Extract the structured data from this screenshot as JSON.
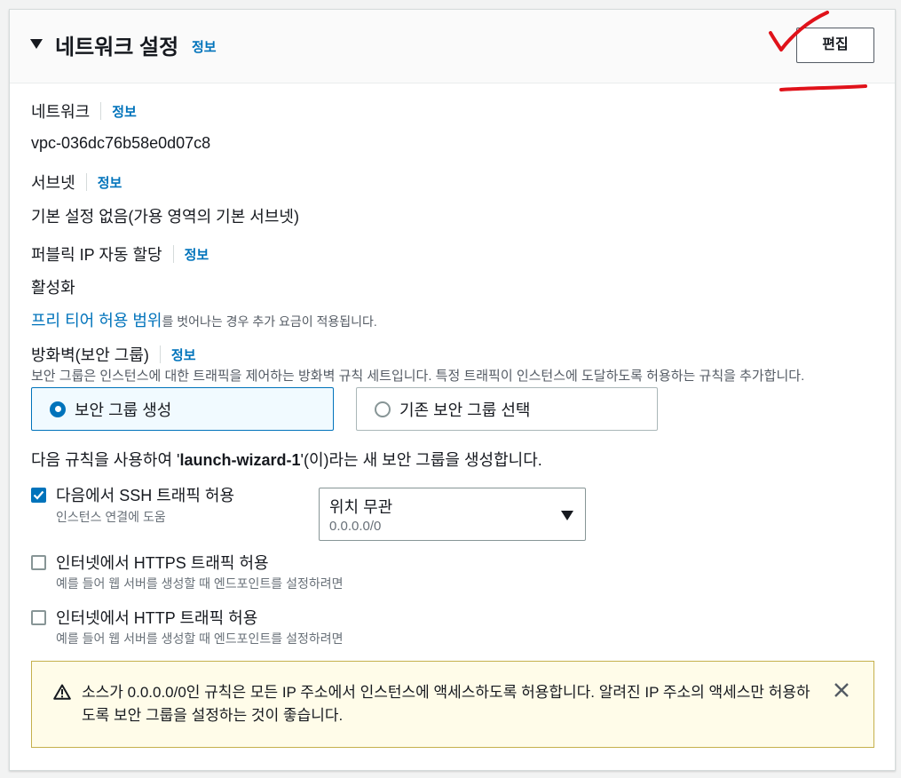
{
  "header": {
    "title": "네트워크 설정",
    "info": "정보",
    "edit_label": "편집"
  },
  "network": {
    "label": "네트워크",
    "info": "정보",
    "value": "vpc-036dc76b58e0d07c8"
  },
  "subnet": {
    "label": "서브넷",
    "info": "정보",
    "value": "기본 설정 없음(가용 영역의 기본 서브넷)"
  },
  "public_ip": {
    "label": "퍼블릭 IP 자동 할당",
    "info": "정보",
    "value": "활성화"
  },
  "free_tier": {
    "link": "프리 티어 허용 범위",
    "suffix": "를 벗어나는 경우 추가 요금이 적용됩니다."
  },
  "firewall": {
    "label": "방화벽(보안 그룹)",
    "info": "정보",
    "description": "보안 그룹은 인스턴스에 대한 트래픽을 제어하는 방화벽 규칙 세트입니다. 특정 트래픽이 인스턴스에 도달하도록 허용하는 규칙을 추가합니다.",
    "option_create": "보안 그룹 생성",
    "option_existing": "기존 보안 그룹 선택",
    "selected": "보안 그룹 생성"
  },
  "rule_sentence": {
    "prefix": "다음 규칙을 사용하여 '",
    "group_name": "launch-wizard-1",
    "suffix": "'(이)라는 새 보안 그룹을 생성합니다."
  },
  "rules": [
    {
      "label": "다음에서 SSH 트래픽 허용",
      "help": "인스턴스 연결에 도움",
      "checked": true
    },
    {
      "label": "인터넷에서 HTTPS 트래픽 허용",
      "help": "예를 들어 웹 서버를 생성할 때 엔드포인트를 설정하려면",
      "checked": false
    },
    {
      "label": "인터넷에서 HTTP 트래픽 허용",
      "help": "예를 들어 웹 서버를 생성할 때 엔드포인트를 설정하려면",
      "checked": false
    }
  ],
  "ssh_source": {
    "value": "위치 무관",
    "sub": "0.0.0.0/0"
  },
  "alert": {
    "text": "소스가 0.0.0.0/0인 규칙은 모든 IP 주소에서 인스턴스에 액세스하도록 허용합니다. 알려진 IP 주소의 액세스만 허용하도록 보안 그룹을 설정하는 것이 좋습니다."
  },
  "colors": {
    "link": "#0073bb",
    "annotation": "#e0121a",
    "warning": "#8d6605"
  }
}
